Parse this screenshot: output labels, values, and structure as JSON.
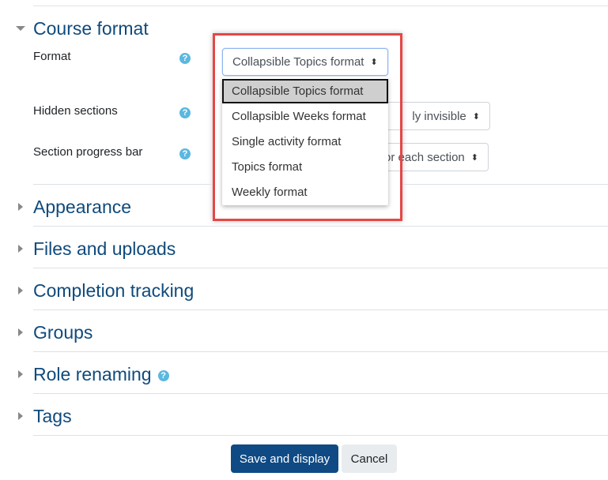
{
  "course_format": {
    "title": "Course format",
    "expanded": true,
    "fields": [
      {
        "label": "Format",
        "value": "Collapsible Topics format"
      },
      {
        "label": "Hidden sections",
        "value": "ly invisible"
      },
      {
        "label": "Section progress bar",
        "value": "or each section"
      }
    ],
    "dropdown_options": [
      "Collapsible Topics format",
      "Collapsible Weeks format",
      "Single activity format",
      "Topics format",
      "Weekly format"
    ],
    "selected_option": "Collapsible Topics format"
  },
  "sections": [
    {
      "title": "Appearance",
      "help": false
    },
    {
      "title": "Files and uploads",
      "help": false
    },
    {
      "title": "Completion tracking",
      "help": false
    },
    {
      "title": "Groups",
      "help": false
    },
    {
      "title": "Role renaming",
      "help": true
    },
    {
      "title": "Tags",
      "help": false
    }
  ],
  "help_glyph": "?",
  "buttons": {
    "save": "Save and display",
    "cancel": "Cancel"
  },
  "colors": {
    "primary": "#0f4a84",
    "heading": "#0f4a7c",
    "help": "#5bb8e0",
    "highlight_box": "#e64646"
  }
}
